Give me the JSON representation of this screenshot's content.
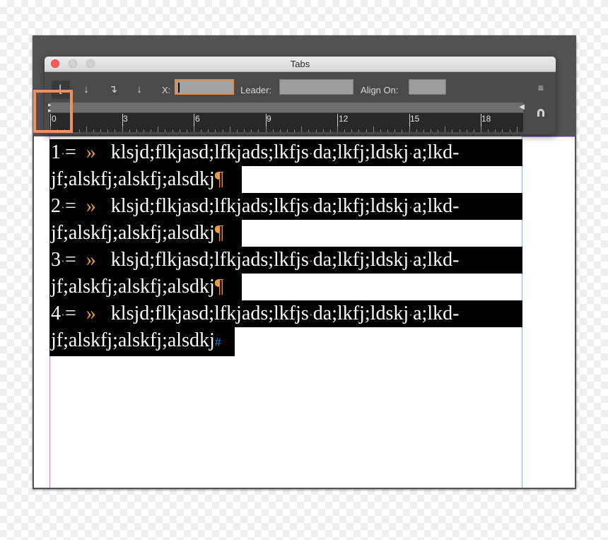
{
  "panel": {
    "title": "Tabs",
    "x_label": "X:",
    "x_value": "",
    "leader_label": "Leader:",
    "leader_value": "",
    "align_on_label": "Align On:",
    "align_on_value": ""
  },
  "tab_buttons": [
    {
      "name": "left-justified-tab",
      "icon": "↓",
      "active": true
    },
    {
      "name": "center-justified-tab",
      "icon": "↓"
    },
    {
      "name": "right-justified-tab",
      "icon": "↓"
    },
    {
      "name": "align-to-decimal-tab",
      "icon": "↓"
    }
  ],
  "ruler": {
    "labels": [
      "0",
      "3",
      "6",
      "9",
      "12",
      "15",
      "18"
    ]
  },
  "text_lines": [
    {
      "num": "1",
      "content": "klsjd;flkjasd;lfkjads;lkfjs",
      "tail": "da;lkfj;ldskj",
      "end": "a;lkd-"
    },
    {
      "cont": "jf;alskfj;alskfj;alsdkj"
    },
    {
      "num": "2",
      "content": "klsjd;flkjasd;lfkjads;lkfjs",
      "tail": "da;lkfj;ldskj",
      "end": "a;lkd-"
    },
    {
      "cont": "jf;alskfj;alskfj;alsdkj"
    },
    {
      "num": "3",
      "content": "klsjd;flkjasd;lfkjads;lkfjs",
      "tail": "da;lkfj;ldskj",
      "end": "a;lkd-"
    },
    {
      "cont": "jf;alskfj;alskfj;alsdkj"
    },
    {
      "num": "4",
      "content": "klsjd;flkjasd;lfkjads;lkfjs",
      "tail": "da;lkfj;ldskj",
      "end": "a;lkd-"
    },
    {
      "cont": "jf;alskfj;alskfj;alsdkj"
    }
  ],
  "colors": {
    "highlight": "#f19062",
    "hidden_char": "#e79b45",
    "workspace": "#535353"
  }
}
